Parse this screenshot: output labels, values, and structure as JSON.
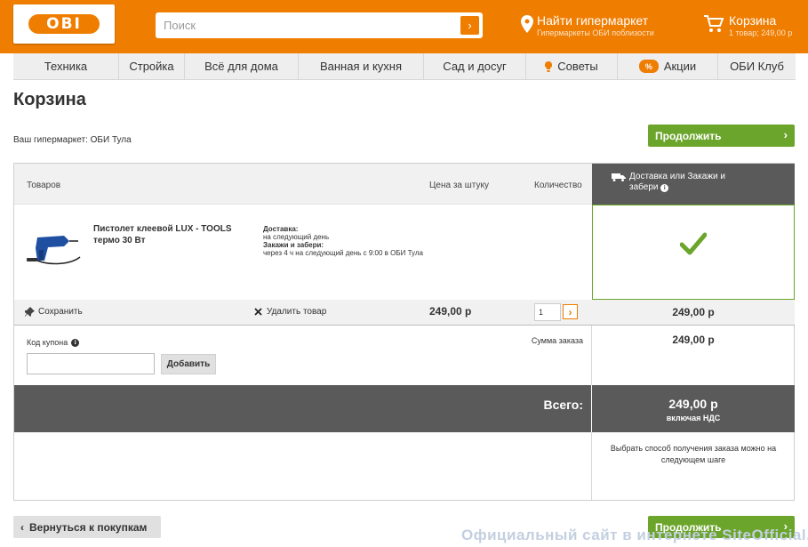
{
  "header": {
    "logo_text": "OBI",
    "search_placeholder": "Поиск",
    "find_store_title": "Найти гипермаркет",
    "find_store_sub": "Гипермаркеты ОБИ поблизости",
    "cart_title": "Корзина",
    "cart_sub": "1 товар; 249,00 р",
    "brand_color": "#ef7d00"
  },
  "nav": {
    "items": [
      {
        "label": "Техника"
      },
      {
        "label": "Стройка"
      },
      {
        "label": "Всё для дома"
      },
      {
        "label": "Ванная и кухня"
      },
      {
        "label": "Сад и досуг"
      },
      {
        "label": "Советы",
        "icon": "lightbulb-icon"
      },
      {
        "label": "Акции",
        "badge": "%"
      },
      {
        "label": "ОБИ Клуб"
      }
    ]
  },
  "page": {
    "title": "Корзина",
    "store_label": "Ваш гипермаркет: ОБИ Тула",
    "continue_label": "Продолжить",
    "continue_chevron": "›",
    "back_chevron": "‹",
    "back_label": "Вернуться к покупкам"
  },
  "table": {
    "col_products": "Товаров",
    "col_price": "Цена за штуку",
    "col_qty": "Количество",
    "delivery_header": "Доставка или Закажи и забери"
  },
  "product": {
    "name": "Пистолет клеевой LUX - TOOLS термо 30 Вт",
    "delivery_title": "Доставка:",
    "delivery_text": "на следующий день",
    "pickup_title": "Закажи и забери:",
    "pickup_text": "через 4 ч на следующий день с 9:00 в ОБИ Тула",
    "save_label": "Сохранить",
    "remove_label": "Удалить товар",
    "price": "249,00 р",
    "quantity": "1",
    "line_total": "249,00 р"
  },
  "coupon": {
    "label": "Код купона",
    "button": "Добавить"
  },
  "summary": {
    "order_sum_label": "Сумма заказа",
    "order_sum_value": "249,00 р",
    "total_label": "Всего:",
    "total_value": "249,00 р",
    "vat_label": "включая НДС",
    "pickup_note": "Выбрать способ получения заказа можно на следующем шаге"
  },
  "watermark": "Официальный сайт в интернете SiteOfficial.ru"
}
